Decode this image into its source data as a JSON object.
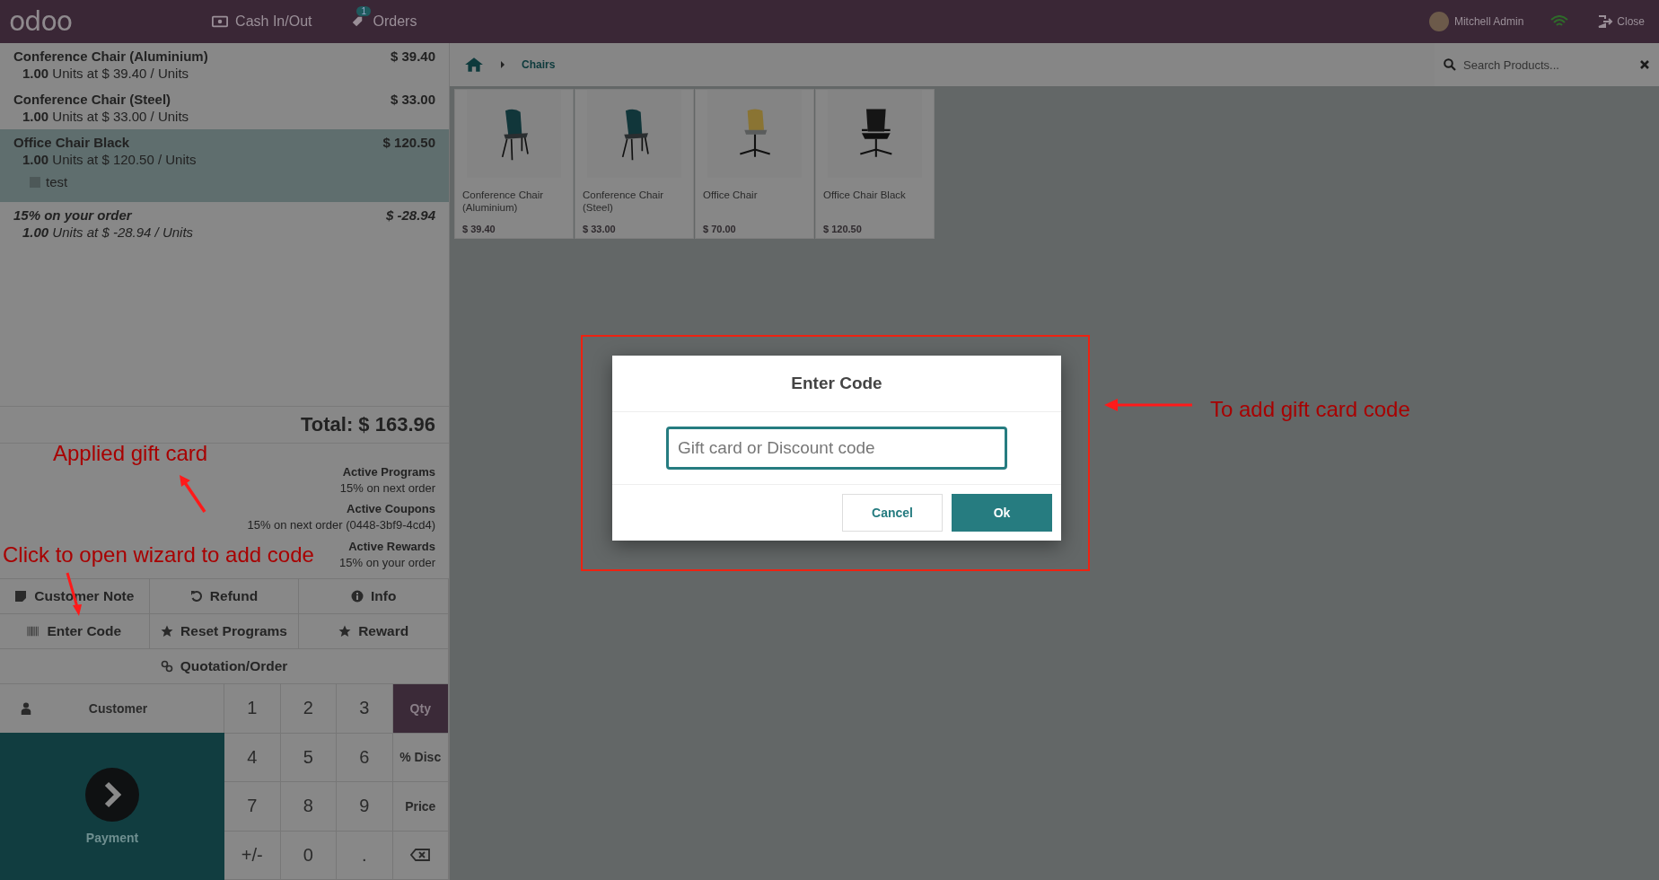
{
  "topbar": {
    "logo": "odoo",
    "nav": [
      {
        "kind": "cash",
        "label": "Cash In/Out"
      },
      {
        "kind": "orders",
        "label": "Orders",
        "badge": "1"
      }
    ],
    "user": "Mitchell Admin",
    "close": "Close"
  },
  "orderlines": [
    {
      "kind": "product",
      "name": "Conference Chair (Aluminium)",
      "price": "$ 39.40",
      "qty": "1.00",
      "detail": "Units at $ 39.40 / Units",
      "selected": false
    },
    {
      "kind": "product",
      "name": "Conference Chair (Steel)",
      "price": "$ 33.00",
      "qty": "1.00",
      "detail": "Units at $ 33.00 / Units",
      "selected": false
    },
    {
      "kind": "product",
      "name": "Office Chair Black",
      "price": "$ 120.50",
      "qty": "1.00",
      "detail": "Units at $ 120.50 / Units",
      "note": "test",
      "selected": true
    },
    {
      "kind": "reward",
      "name": "15% on your order",
      "price": "$ -28.94",
      "qty": "1.00",
      "detail": "Units at $ -28.94 / Units",
      "selected": false
    }
  ],
  "total": "Total: $ 163.96",
  "summary": [
    {
      "title": "Active Programs",
      "text": "15% on next order"
    },
    {
      "title": "Active Coupons",
      "text": "15% on next order (0448-3bf9-4cd4)"
    },
    {
      "title": "Active Rewards",
      "text": "15% on your order"
    }
  ],
  "controls": [
    [
      {
        "kind": "note",
        "label": "Customer Note"
      },
      {
        "kind": "refund",
        "label": "Refund"
      },
      {
        "kind": "info",
        "label": "Info"
      }
    ],
    [
      {
        "kind": "code",
        "label": "Enter Code"
      },
      {
        "kind": "programs",
        "label": "Reset Programs"
      },
      {
        "kind": "reward",
        "label": "Reward"
      }
    ],
    [
      {
        "kind": "quotation",
        "label": "Quotation/Order"
      }
    ]
  ],
  "customer": "Customer",
  "payment": "Payment",
  "numpad": [
    {
      "kind": "digit",
      "label": "1"
    },
    {
      "kind": "digit",
      "label": "2"
    },
    {
      "kind": "digit",
      "label": "3"
    },
    {
      "kind": "mode",
      "label": "Qty",
      "selected": true
    },
    {
      "kind": "digit",
      "label": "4"
    },
    {
      "kind": "digit",
      "label": "5"
    },
    {
      "kind": "digit",
      "label": "6"
    },
    {
      "kind": "mode",
      "label": "% Disc",
      "selected": false
    },
    {
      "kind": "digit",
      "label": "7"
    },
    {
      "kind": "digit",
      "label": "8"
    },
    {
      "kind": "digit",
      "label": "9"
    },
    {
      "kind": "mode",
      "label": "Price",
      "selected": false
    },
    {
      "kind": "digit",
      "label": "+/-"
    },
    {
      "kind": "digit",
      "label": "0"
    },
    {
      "kind": "digit",
      "label": "."
    },
    {
      "kind": "backspace"
    }
  ],
  "breadcrumb": [
    "Chairs"
  ],
  "search": {
    "placeholder": "Search Products..."
  },
  "products": [
    {
      "name": "Conference Chair (Aluminium)",
      "price": "$ 39.40",
      "kind": "dining"
    },
    {
      "name": "Conference Chair (Steel)",
      "price": "$ 33.00",
      "kind": "dining"
    },
    {
      "name": "Office Chair",
      "price": "$ 70.00",
      "kind": "swivel"
    },
    {
      "name": "Office Chair Black",
      "price": "$ 120.50",
      "kind": "office"
    }
  ],
  "dialog": {
    "title": "Enter Code",
    "placeholder": "Gift card or Discount code",
    "buttons": [
      {
        "kind": "secondary",
        "label": "Cancel"
      },
      {
        "kind": "primary",
        "label": "Ok"
      }
    ]
  },
  "annotations": [
    {
      "text": "Applied gift card"
    },
    {
      "text": "Click to open wizard to add code"
    },
    {
      "text": "To add gift card code"
    }
  ]
}
